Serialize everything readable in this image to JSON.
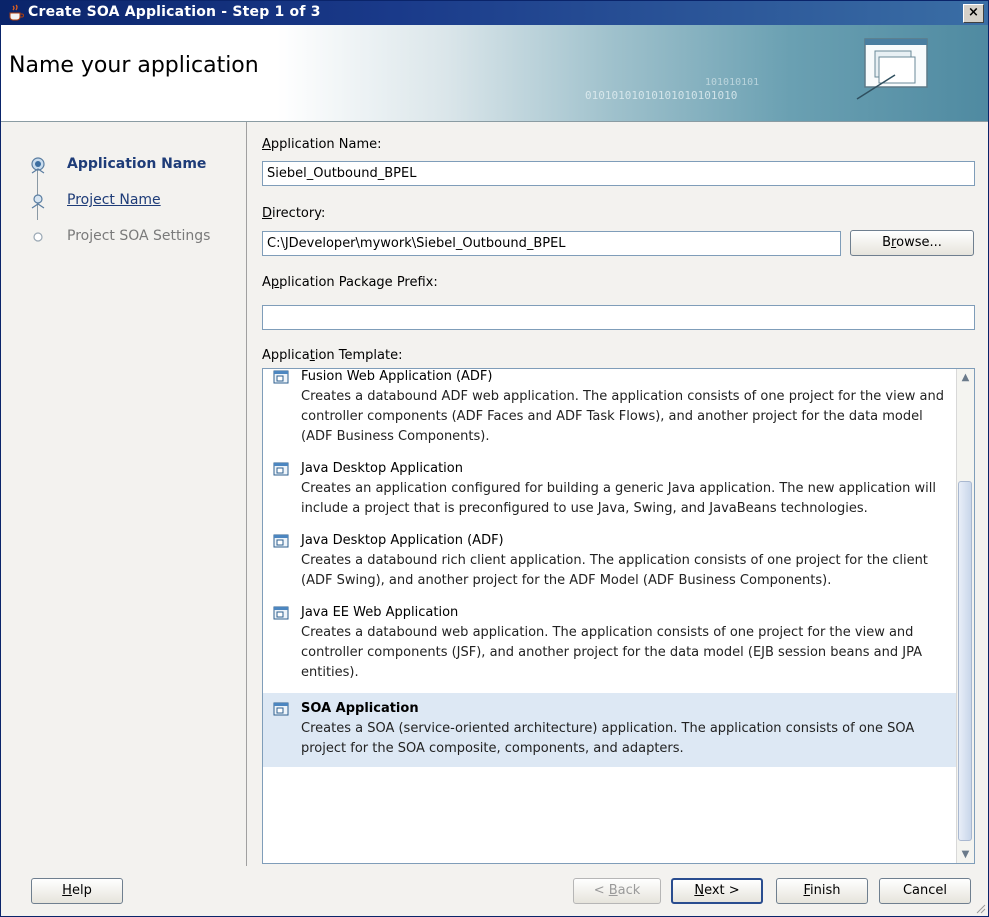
{
  "window": {
    "title": "Create SOA Application - Step 1 of 3",
    "close_label": "×"
  },
  "banner": {
    "heading": "Name your application",
    "binary_text_1": "01010101010101010101010",
    "binary_text_2": "101010101"
  },
  "steps": [
    {
      "label": "Application Name",
      "state": "current"
    },
    {
      "label": "Project Name",
      "state": "link"
    },
    {
      "label": "Project SOA Settings",
      "state": "disabled"
    }
  ],
  "form": {
    "app_name_label_mn": "A",
    "app_name_label_rest": "pplication Name:",
    "app_name_value": "Siebel_Outbound_BPEL",
    "directory_label_mn": "D",
    "directory_label_rest": "irectory:",
    "directory_value": "C:\\JDeveloper\\mywork\\Siebel_Outbound_BPEL",
    "browse_pre": "B",
    "browse_mn": "r",
    "browse_post": "owse...",
    "prefix_label_pre": "A",
    "prefix_label_mn": "p",
    "prefix_label_post": "plication Package Prefix:",
    "prefix_value": "",
    "template_label_pre": "Applica",
    "template_label_mn": "t",
    "template_label_post": "ion Template:"
  },
  "templates": [
    {
      "title": "Fusion Web Application (ADF)",
      "description": "Creates a databound ADF web application. The application consists of one project for the view and controller components (ADF Faces and ADF Task Flows), and another project for the data model (ADF Business Components).",
      "selected": false
    },
    {
      "title": "Java Desktop Application",
      "description": "Creates an application configured for building a generic Java application. The new application will include a project that is preconfigured to use Java, Swing, and JavaBeans technologies.",
      "selected": false
    },
    {
      "title": "Java Desktop Application (ADF)",
      "description": "Creates a databound rich client application. The application consists of one project for the client (ADF Swing), and another project for the ADF Model (ADF Business Components).",
      "selected": false
    },
    {
      "title": "Java EE Web Application",
      "description": "Creates a databound web application. The application consists of one project for the view and controller components (JSF), and another project for the data model (EJB session beans and JPA entities).",
      "selected": false
    },
    {
      "title": "SOA Application",
      "description": "Creates a SOA (service-oriented architecture) application. The application consists of one SOA project for the SOA composite, components, and adapters.",
      "selected": true
    }
  ],
  "buttons": {
    "help_mn": "H",
    "help_rest": "elp",
    "back_pre": "< ",
    "back_mn": "B",
    "back_rest": "ack",
    "next_mn": "N",
    "next_rest": "ext >",
    "finish_mn": "F",
    "finish_rest": "inish",
    "cancel": "Cancel"
  },
  "colors": {
    "title_bar": "#0a246a",
    "selection": "#dde8f4",
    "link": "#1e3c78"
  }
}
